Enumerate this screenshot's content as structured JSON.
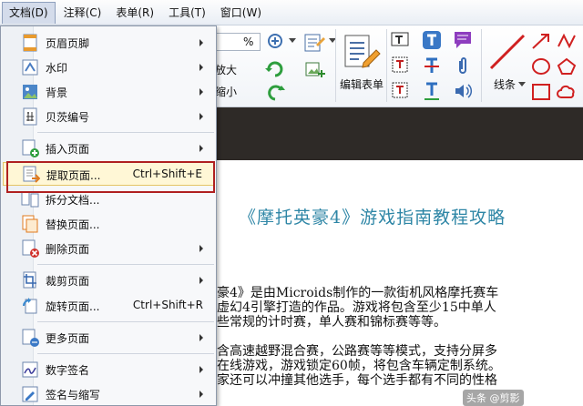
{
  "menubar": {
    "items": [
      {
        "label": "文档(D)"
      },
      {
        "label": "注释(C)"
      },
      {
        "label": "表单(R)"
      },
      {
        "label": "工具(T)"
      },
      {
        "label": "窗口(W)"
      }
    ]
  },
  "toolbar": {
    "zoom_value": "%",
    "zoom_in_label": "放大",
    "zoom_out_label": "缩小",
    "edit_form_label": "编辑表单",
    "lines_label": "线条"
  },
  "menu": {
    "items": [
      {
        "label": "页眉页脚",
        "icon": "header-footer-icon",
        "has_submenu": true
      },
      {
        "label": "水印",
        "icon": "watermark-icon",
        "has_submenu": true
      },
      {
        "label": "背景",
        "icon": "background-icon",
        "has_submenu": true
      },
      {
        "label": "贝茨编号",
        "icon": "bates-number-icon",
        "has_submenu": true
      },
      {
        "label": "插入页面",
        "icon": "insert-page-icon",
        "has_submenu": true
      },
      {
        "label": "提取页面...",
        "icon": "extract-page-icon",
        "shortcut": "Ctrl+Shift+E",
        "highlighted": true
      },
      {
        "label": "拆分文档...",
        "icon": "split-document-icon"
      },
      {
        "label": "替换页面...",
        "icon": "replace-page-icon"
      },
      {
        "label": "删除页面",
        "icon": "delete-page-icon",
        "has_submenu": true
      },
      {
        "label": "裁剪页面",
        "icon": "crop-page-icon",
        "has_submenu": true
      },
      {
        "label": "旋转页面...",
        "icon": "rotate-page-icon",
        "shortcut": "Ctrl+Shift+R"
      },
      {
        "label": "更多页面",
        "icon": "more-pages-icon",
        "has_submenu": true
      },
      {
        "label": "数字签名",
        "icon": "digital-signature-icon",
        "has_submenu": true
      },
      {
        "label": "签名与缩写",
        "icon": "sign-initials-icon",
        "has_submenu": true
      }
    ]
  },
  "document": {
    "title": "《摩托英豪4》游戏指南教程攻略",
    "lines": [
      "豪4》是由Microids制作的一款街机风格摩托赛车",
      "虚幻4引擎打造的作品。游戏将包含至少15中单人",
      "些常规的计时赛，单人赛和锦标赛等等。",
      "含高速越野混合赛，公路赛等等模式，支持分屏多",
      "在线游戏，游戏锁定60帧，将包含车辆定制系统。",
      "家还可以冲撞其他选手，每个选手都有不同的性格"
    ],
    "watermark": "头条 @剪影"
  },
  "colors": {
    "title_blue": "#2e86a6",
    "highlight_border": "#b02020",
    "dark_band": "#2e2a27"
  }
}
